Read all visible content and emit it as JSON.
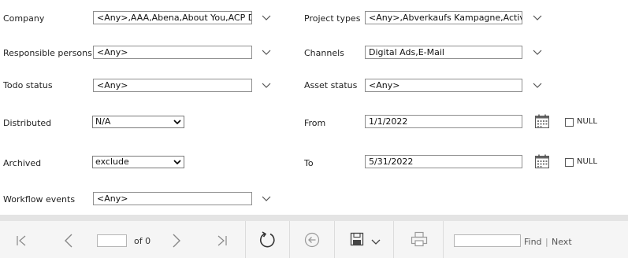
{
  "filters": {
    "company": {
      "label": "Company",
      "value": "<Any>,AAA,Abena,About You,ACP D"
    },
    "responsible": {
      "label": "Responsible persons",
      "value": "<Any>"
    },
    "todo_status": {
      "label": "Todo status",
      "value": "<Any>"
    },
    "distributed": {
      "label": "Distributed",
      "value": "N/A"
    },
    "archived": {
      "label": "Archived",
      "value": "exclude"
    },
    "workflow_events": {
      "label": "Workflow events",
      "value": "<Any>"
    },
    "project_types": {
      "label": "Project types",
      "value": "<Any>,Abverkaufs Kampagne,Activa"
    },
    "channels": {
      "label": "Channels",
      "value": "Digital Ads,E-Mail"
    },
    "asset_status": {
      "label": "Asset status",
      "value": "<Any>"
    },
    "from": {
      "label": "From",
      "value": "1/1/2022",
      "null_label": "NULL"
    },
    "to": {
      "label": "To",
      "value": "5/31/2022",
      "null_label": "NULL"
    }
  },
  "toolbar": {
    "page_value": "",
    "of_label": "of 0",
    "find_value": "",
    "find_label": "Find",
    "separator": "|",
    "next_label": "Next"
  },
  "icons": [
    "first-page-icon",
    "prev-page-icon",
    "next-page-icon",
    "last-page-icon",
    "refresh-icon",
    "back-icon",
    "save-icon",
    "print-icon",
    "calendar-icon",
    "chevron-down-icon"
  ]
}
